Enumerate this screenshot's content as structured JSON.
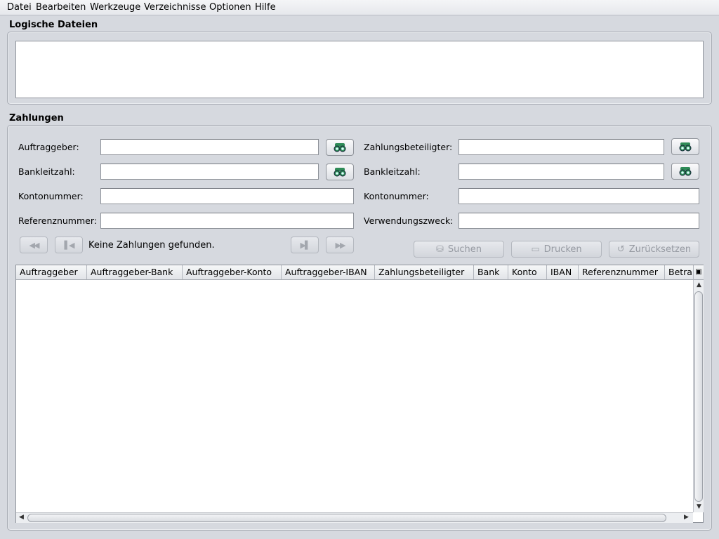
{
  "menu": [
    "Datei",
    "Bearbeiten",
    "Werkzeuge",
    "Verzeichnisse",
    "Optionen",
    "Hilfe"
  ],
  "logical_files": {
    "title": "Logische Dateien"
  },
  "payments": {
    "title": "Zahlungen",
    "left_fields": {
      "auftraggeber": {
        "label": "Auftraggeber:",
        "value": ""
      },
      "bankleitzahl": {
        "label": "Bankleitzahl:",
        "value": ""
      },
      "kontonummer": {
        "label": "Kontonummer:",
        "value": ""
      },
      "referenznummer": {
        "label": "Referenznummer:",
        "value": ""
      }
    },
    "right_fields": {
      "zahlungsbeteiligter": {
        "label": "Zahlungsbeteiligter:",
        "value": ""
      },
      "bankleitzahl": {
        "label": "Bankleitzahl:",
        "value": ""
      },
      "kontonummer": {
        "label": "Kontonummer:",
        "value": ""
      },
      "verwendungszweck": {
        "label": "Verwendungszweck:",
        "value": ""
      }
    },
    "status_text": "Keine Zahlungen gefunden.",
    "buttons": {
      "search": "Suchen",
      "print": "Drucken",
      "reset": "Zurücksetzen"
    },
    "nav_icons": [
      "first-page-icon",
      "previous-page-icon",
      "next-page-icon",
      "last-page-icon"
    ],
    "table": {
      "columns": [
        "Auftraggeber",
        "Auftraggeber-Bank",
        "Auftraggeber-Konto",
        "Auftraggeber-IBAN",
        "Zahlungsbeteiligter",
        "Bank",
        "Konto",
        "IBAN",
        "Referenznummer",
        "Betra"
      ],
      "rows": []
    }
  },
  "colors": {
    "background": "#d6d9df",
    "lookup_icon": "#2e8b57",
    "disabled_text": "#969aa2"
  }
}
